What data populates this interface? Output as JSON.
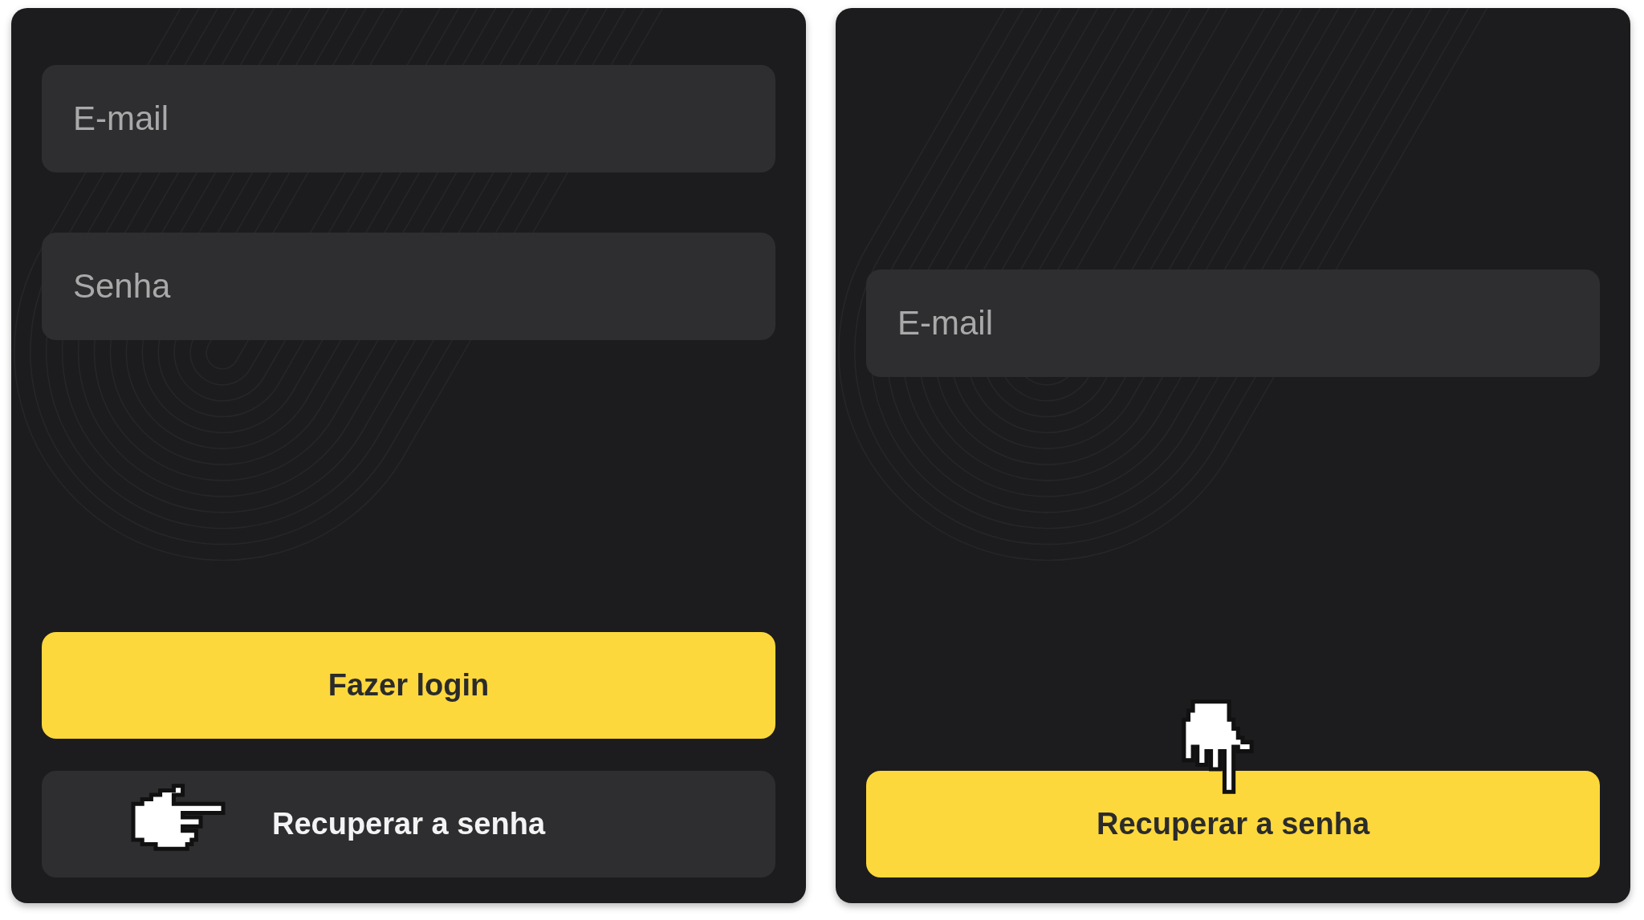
{
  "panels": [
    {
      "kind": "login",
      "fields": [
        {
          "placeholder": "E-mail"
        },
        {
          "placeholder": "Senha"
        }
      ],
      "buttons": [
        {
          "label": "Fazer login",
          "kind": "primary",
          "hovered": false
        },
        {
          "label": "Recuperar a senha",
          "kind": "secondary",
          "hovered": true
        }
      ]
    },
    {
      "kind": "recovery",
      "fields": [
        {
          "placeholder": "E-mail"
        }
      ],
      "buttons": [
        {
          "label": "Recuperar a senha",
          "kind": "primary",
          "hovered": true
        }
      ]
    }
  ]
}
